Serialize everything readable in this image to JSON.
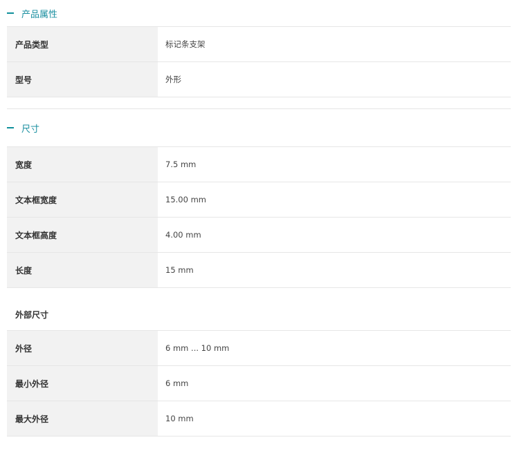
{
  "sections": [
    {
      "title": "产品属性",
      "rows": [
        {
          "label": "产品类型",
          "value": "标记条支架"
        },
        {
          "label": "型号",
          "value": "外形"
        }
      ]
    },
    {
      "title": "尺寸",
      "rows": [
        {
          "label": "宽度",
          "value": "7.5 mm"
        },
        {
          "label": "文本框宽度",
          "value": "15.00 mm"
        },
        {
          "label": "文本框高度",
          "value": "4.00 mm"
        },
        {
          "label": "长度",
          "value": "15 mm"
        }
      ],
      "subgroup": {
        "title": "外部尺寸",
        "rows": [
          {
            "label": "外径",
            "value": "6 mm ... 10 mm"
          },
          {
            "label": "最小外径",
            "value": "6 mm"
          },
          {
            "label": "最大外径",
            "value": "10 mm"
          }
        ]
      }
    }
  ],
  "colors": {
    "accent": "#1a8fa0",
    "label_bg": "#f2f2f2",
    "border": "#e6e6e6"
  },
  "icons": {
    "section_toggle": "minus-icon"
  }
}
